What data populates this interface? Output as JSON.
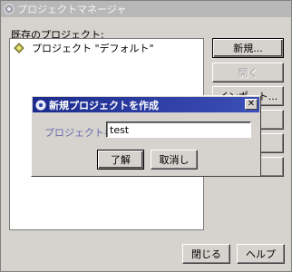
{
  "window": {
    "title": "プロジェクトマネージャ"
  },
  "main": {
    "existing_label": "既存のプロジェクト:",
    "projects": [
      {
        "name": "プロジェクト \"デフォルト\""
      }
    ]
  },
  "side_buttons": {
    "new": "新規...",
    "open": "開く",
    "import": "インポート..."
  },
  "footer": {
    "close": "閉じる",
    "help": "ヘルプ"
  },
  "dialog": {
    "title": "新規プロジェクトを作成",
    "name_label": "プロジェクト名:",
    "name_value": "test",
    "ok": "了解",
    "cancel": "取消し"
  }
}
